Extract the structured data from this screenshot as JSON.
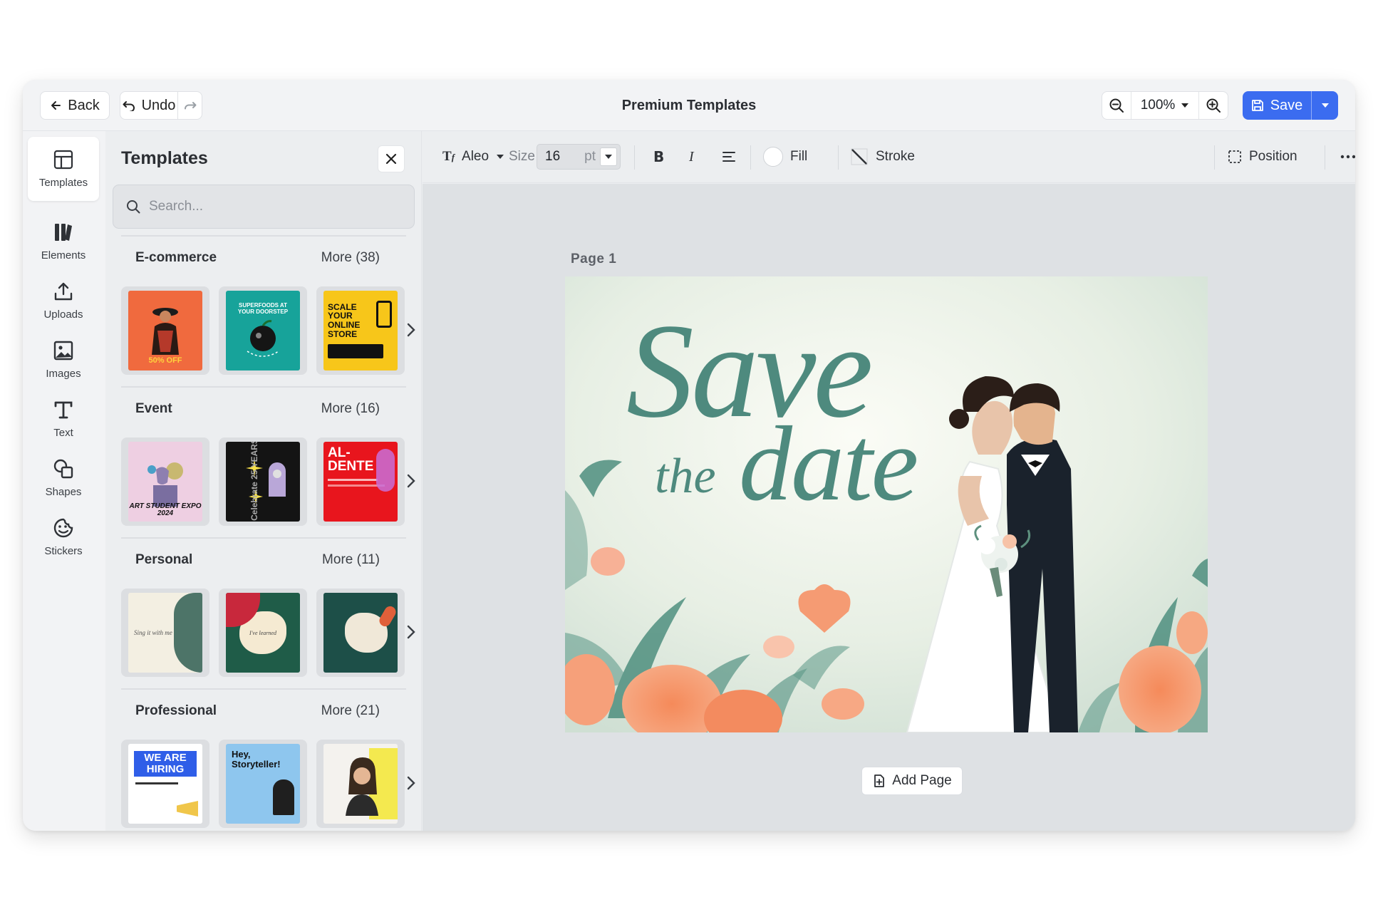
{
  "topbar": {
    "back_label": "Back",
    "undo_label": "Undo",
    "title": "Premium Templates",
    "zoom_value": "100%",
    "save_label": "Save"
  },
  "rail": {
    "items": [
      {
        "label": "Templates",
        "icon": "layout-icon"
      },
      {
        "label": "Elements",
        "icon": "elements-icon"
      },
      {
        "label": "Uploads",
        "icon": "upload-icon"
      },
      {
        "label": "Images",
        "icon": "image-icon"
      },
      {
        "label": "Text",
        "icon": "text-icon"
      },
      {
        "label": "Shapes",
        "icon": "shapes-icon"
      },
      {
        "label": "Stickers",
        "icon": "sticker-icon"
      }
    ]
  },
  "panel": {
    "title": "Templates",
    "search_placeholder": "Search...",
    "categories": [
      {
        "name": "E-commerce",
        "more": "More (38)",
        "thumbs": [
          {
            "text": "50% OFF",
            "bg": "#f06a3e"
          },
          {
            "text": "SUPERFOODS AT YOUR DOORSTEP",
            "bg": "#17a39a"
          },
          {
            "text": "SCALE YOUR ONLINE STORE",
            "bg": "#f7c61a"
          }
        ]
      },
      {
        "name": "Event",
        "more": "More (16)",
        "thumbs": [
          {
            "text": "ART STUDENT EXPO 2024",
            "bg": "#eecfe2"
          },
          {
            "text": "Celebrate 25 YEARS",
            "bg": "#141414"
          },
          {
            "text": "AL-DENTE",
            "bg": "#e8151d"
          }
        ]
      },
      {
        "name": "Personal",
        "more": "More (11)",
        "thumbs": [
          {
            "text": "Sing it with me",
            "bg": "#f3efe2"
          },
          {
            "text": "I've learned",
            "bg": "#1f5c48"
          },
          {
            "text": "",
            "bg": "#1d4f48"
          }
        ]
      },
      {
        "name": "Professional",
        "more": "More (21)",
        "thumbs": [
          {
            "text": "WE ARE HIRING",
            "bg": "#ffffff"
          },
          {
            "text": "Hey, Storyteller!",
            "bg": "#8ec6ee"
          },
          {
            "text": "",
            "bg": "#f4e94f"
          }
        ]
      }
    ]
  },
  "toolbar": {
    "font": "Aleo",
    "size_label": "Size",
    "size_value": "16",
    "size_unit": "pt",
    "fill_label": "Fill",
    "stroke_label": "Stroke",
    "position_label": "Position"
  },
  "canvas": {
    "page_label": "Page  1",
    "headline_line1": "Save",
    "headline_line2a": "the",
    "headline_line2b": "date",
    "add_page_label": "Add Page"
  },
  "colors": {
    "accent": "#3b6cf0",
    "headline": "#4e8a7e",
    "flower": "#f28a5e",
    "leaf": "#4f8f7f"
  }
}
